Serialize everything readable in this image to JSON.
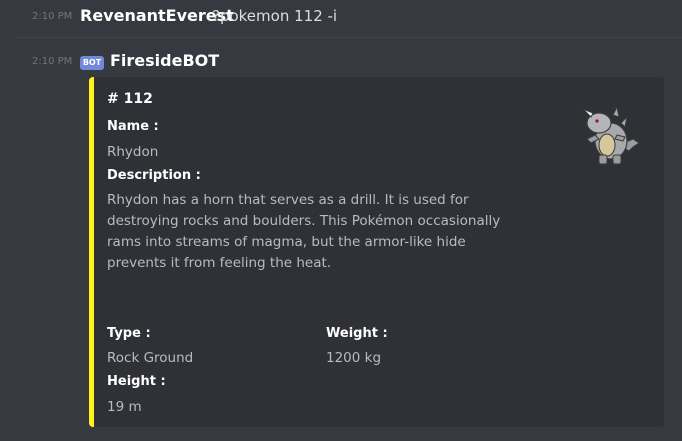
{
  "messages": [
    {
      "timestamp": "2:10 PM",
      "author": "RevenantEverest",
      "content": "?pokemon 112 -i"
    },
    {
      "timestamp": "2:10 PM",
      "bot_tag": "BOT",
      "author": "FiresideBOT"
    }
  ],
  "embed": {
    "accent_color": "#fff21b",
    "title": "# 112",
    "thumbnail_icon": "rhydon-sprite",
    "fields": {
      "name_label": "Name :",
      "name_value": "Rhydon",
      "description_label": "Description :",
      "description_value": "Rhydon has a horn that serves as a drill. It is used for destroying rocks and boulders. This Pokémon occasionally rams into streams of magma, but the armor-like hide prevents it from feeling the heat.",
      "type_label": "Type :",
      "type_value": "Rock Ground",
      "weight_label": "Weight :",
      "weight_value": "1200 kg",
      "height_label": "Height :",
      "height_value": "19 m"
    }
  }
}
